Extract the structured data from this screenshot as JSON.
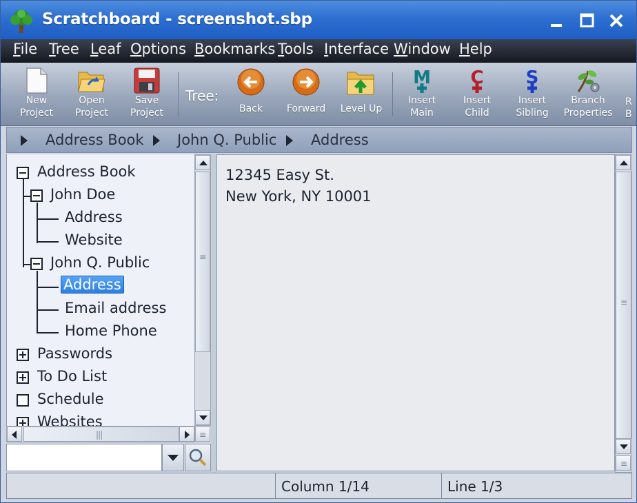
{
  "window": {
    "title": "Scratchboard - screenshot.sbp"
  },
  "menu": [
    {
      "label": "File",
      "mnemonic": "F",
      "rest": "ile"
    },
    {
      "label": "Tree",
      "mnemonic": "T",
      "rest": "ree"
    },
    {
      "label": "Leaf",
      "mnemonic": "L",
      "rest": "eaf"
    },
    {
      "label": "Options",
      "mnemonic": "O",
      "rest": "ptions"
    },
    {
      "label": "Bookmarks",
      "mnemonic": "B",
      "rest": "ookmarks"
    },
    {
      "label": "Tools",
      "mnemonic": "T",
      "rest": "ools"
    },
    {
      "label": "Interface",
      "mnemonic": "I",
      "rest": "nterface"
    },
    {
      "label": "Window",
      "mnemonic": "W",
      "rest": "indow"
    },
    {
      "label": "Help",
      "mnemonic": "H",
      "rest": "elp"
    }
  ],
  "toolbar": {
    "tree_label": "Tree:",
    "buttons": [
      {
        "line1": "New",
        "line2": "Project",
        "icon": "new-document-icon"
      },
      {
        "line1": "Open",
        "line2": "Project",
        "icon": "open-folder-icon"
      },
      {
        "line1": "Save",
        "line2": "Project",
        "icon": "floppy-disk-icon"
      },
      {
        "line1": "Back",
        "line2": "",
        "icon": "back-arrow-icon"
      },
      {
        "line1": "Forward",
        "line2": "",
        "icon": "forward-arrow-icon"
      },
      {
        "line1": "Level Up",
        "line2": "",
        "icon": "level-up-folder-icon"
      },
      {
        "line1": "Insert",
        "line2": "Main",
        "icon": "insert-main-icon"
      },
      {
        "line1": "Insert",
        "line2": "Child",
        "icon": "insert-child-icon"
      },
      {
        "line1": "Insert",
        "line2": "Sibling",
        "icon": "insert-sibling-icon"
      },
      {
        "line1": "Branch",
        "line2": "Properties",
        "icon": "branch-properties-icon"
      },
      {
        "line1": "R",
        "line2": "B",
        "icon": "truncated-icon"
      }
    ]
  },
  "breadcrumb": [
    "Address Book",
    "John Q. Public",
    "Address"
  ],
  "tree": [
    {
      "label": "Address Book",
      "state": "expanded"
    },
    {
      "label": "John Doe",
      "state": "expanded"
    },
    {
      "label": "Address",
      "state": "leaf"
    },
    {
      "label": "Website",
      "state": "leaf"
    },
    {
      "label": "John Q. Public",
      "state": "expanded"
    },
    {
      "label": "Address",
      "state": "leaf",
      "selected": true
    },
    {
      "label": "Email address",
      "state": "leaf"
    },
    {
      "label": "Home Phone",
      "state": "leaf"
    },
    {
      "label": "Passwords",
      "state": "collapsed"
    },
    {
      "label": "To Do List",
      "state": "collapsed"
    },
    {
      "label": "Schedule",
      "state": "empty"
    },
    {
      "label": "Websites",
      "state": "collapsed"
    }
  ],
  "search": {
    "value": ""
  },
  "editor": {
    "lines": [
      "12345 Easy St.",
      "New York, NY 10001"
    ]
  },
  "status": {
    "column": "Column 1/14",
    "line": "Line 1/3"
  },
  "colors": {
    "titlebar": "#2d6fd1",
    "menubar": "#15181f",
    "selection": "#2c7fe2"
  }
}
